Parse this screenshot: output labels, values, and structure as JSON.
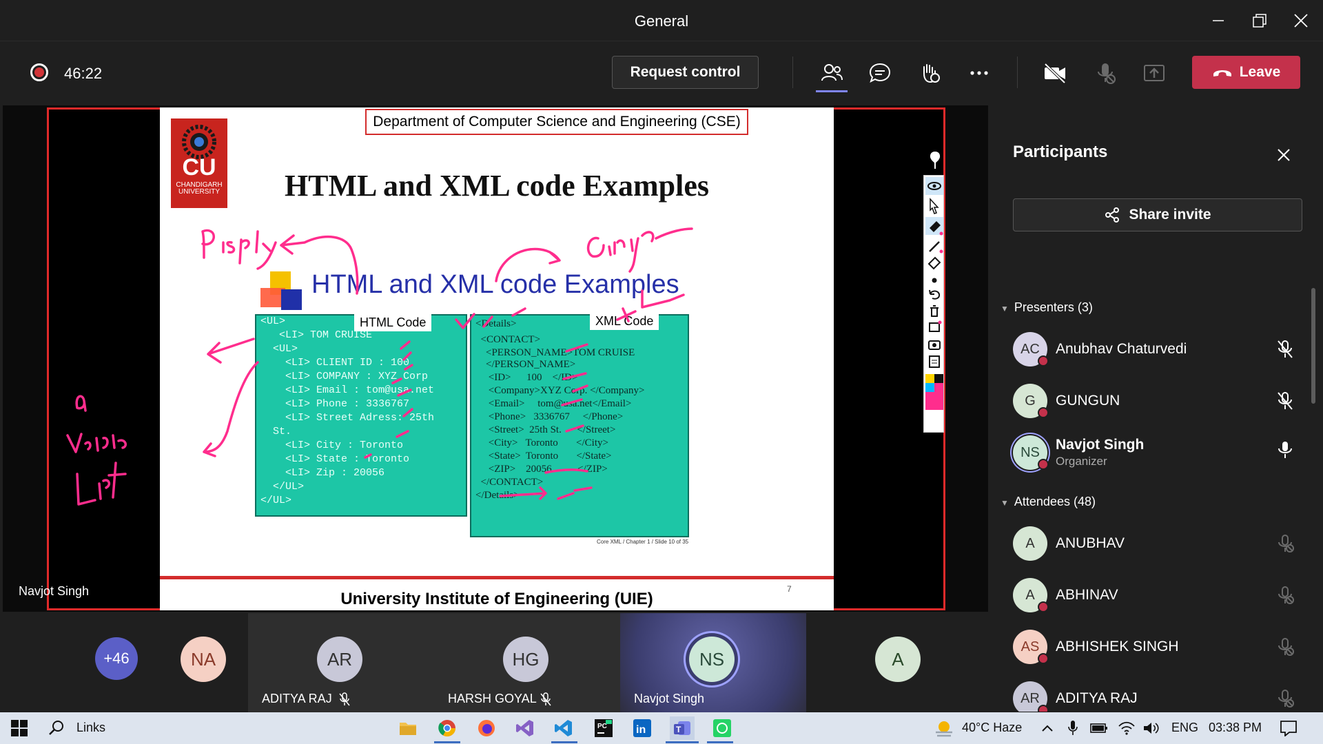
{
  "window": {
    "title": "General"
  },
  "toolbar": {
    "timer": "46:22",
    "request_control": "Request control",
    "leave": "Leave"
  },
  "stage": {
    "presenter_name": "Navjot Singh",
    "slide": {
      "department": "Department of Computer Science and Engineering (CSE)",
      "logo_text": "CU",
      "logo_subtext": "CHANDIGARH UNIVERSITY",
      "title": "HTML and XML code Examples",
      "inner_title": "HTML and XML code Examples",
      "html_label": "HTML Code",
      "xml_label": "XML Code",
      "html_lines": [
        "<UL>",
        "   <LI> TOM CRUISE",
        "  <UL>",
        "    <LI> CLIENT ID : 100",
        "    <LI> COMPANY : XYZ Corp",
        "    <LI> Email : tom@usa.net",
        "    <LI> Phone : 3336767",
        "    <LI> Street Adress: 25th",
        "  St.",
        "    <LI> City : Toronto",
        "    <LI> State : Toronto",
        "    <LI> Zip : 20056",
        "  </UL>",
        "</UL>"
      ],
      "xml_lines": [
        "<Details>",
        "  <CONTACT>",
        "    <PERSON_NAME>TOM CRUISE",
        "    </PERSON_NAME>",
        "     <ID>      100    </ID>",
        "     <Company>XYZ Corp. </Company>",
        "     <Email>     tom@usa.net</Email>",
        "     <Phone>   3336767     </Phone>",
        "     <Street>  25th St.      </Street>",
        "     <City>   Toronto       </City>",
        "     <State>  Toronto       </State>",
        "     <ZIP>    20056          </ZIP>",
        "  </CONTACT>",
        "</Details>"
      ],
      "credit": "Core XML / Chapter 1 / Slide 10 of 35",
      "footer": "University Institute of Engineering (UIE)",
      "page_number": "7"
    }
  },
  "strip": {
    "overflow_count": "+46",
    "tiles": [
      {
        "initials": "NA",
        "name": ""
      },
      {
        "initials": "AR",
        "name": "ADITYA RAJ"
      },
      {
        "initials": "HG",
        "name": "HARSH GOYAL"
      },
      {
        "initials": "NS",
        "name": "Navjot Singh"
      },
      {
        "initials": "A",
        "name": ""
      }
    ]
  },
  "participants": {
    "title": "Participants",
    "share_invite": "Share invite",
    "presenters_heading": "Presenters (3)",
    "attendees_heading": "Attendees (48)",
    "presenters": [
      {
        "initials": "AC",
        "name": "Anubhav Chaturvedi",
        "role": ""
      },
      {
        "initials": "G",
        "name": "GUNGUN",
        "role": ""
      },
      {
        "initials": "NS",
        "name": "Navjot Singh",
        "role": "Organizer"
      }
    ],
    "attendees": [
      {
        "initials": "A",
        "name": "ANUBHAV"
      },
      {
        "initials": "A",
        "name": "ABHINAV"
      },
      {
        "initials": "AS",
        "name": "ABHISHEK SINGH"
      },
      {
        "initials": "AR",
        "name": "ADITYA RAJ"
      }
    ]
  },
  "taskbar": {
    "search_label": "Links",
    "weather": "40°C  Haze",
    "language": "ENG",
    "time": "03:38 PM"
  },
  "colors": {
    "accent_red": "#c4314b",
    "slide_box": "#1dc6a6",
    "ink_pink": "#ff2d8d"
  }
}
